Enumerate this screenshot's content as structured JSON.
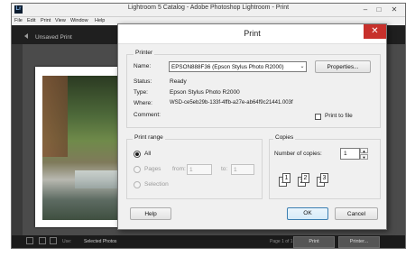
{
  "lightroom": {
    "title": "Lightroom 5 Catalog - Adobe Photoshop Lightroom - Print",
    "app_icon_text": "Lr",
    "menu": [
      "File",
      "Edit",
      "Print",
      "View",
      "Window",
      "Help"
    ],
    "subtitle": "Unsaved Print",
    "bottom": {
      "use_label": "Use:",
      "use_value": "Selected Photos",
      "page_info": "Page 1 of 1",
      "print_button": "Print",
      "printer_button": "Printer..."
    }
  },
  "dialog": {
    "title": "Print",
    "close_glyph": "✕",
    "printer": {
      "group_title": "Printer",
      "name_label": "Name:",
      "name_value": "EPSON888F36 (Epson Stylus Photo R2000)",
      "properties_button": "Properties...",
      "status_label": "Status:",
      "status_value": "Ready",
      "type_label": "Type:",
      "type_value": "Epson Stylus Photo R2000",
      "where_label": "Where:",
      "where_value": "WSD-ce5eb29b-133f-4ffb-a27e-ab64f9c21441.003f",
      "comment_label": "Comment:",
      "print_to_file_label": "Print to file"
    },
    "print_range": {
      "group_title": "Print range",
      "all_label": "All",
      "pages_label": "Pages",
      "from_label": "from:",
      "from_value": "1",
      "to_label": "to:",
      "to_value": "1",
      "selection_label": "Selection",
      "selected": "All"
    },
    "copies": {
      "group_title": "Copies",
      "number_label": "Number of copies:",
      "number_value": "1",
      "collate_pages": [
        "1",
        "1",
        "2",
        "2",
        "3",
        "3"
      ]
    },
    "buttons": {
      "help": "Help",
      "ok": "OK",
      "cancel": "Cancel"
    }
  }
}
